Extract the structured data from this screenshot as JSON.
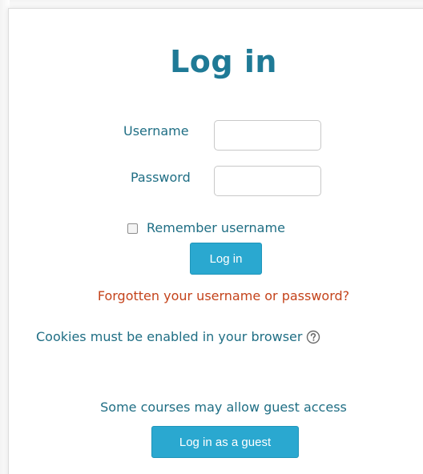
{
  "login": {
    "title": "Log in",
    "username_label": "Username",
    "username_value": "",
    "password_label": "Password",
    "password_value": "",
    "remember_label": "Remember username",
    "remember_checked": false,
    "login_button": "Log in",
    "forgot_link": "Forgotten your username or password?",
    "cookies_text": "Cookies must be enabled in your browser",
    "help_icon": "question-circle-icon",
    "guest_note": "Some courses may allow guest access",
    "guest_button": "Log in as a guest"
  },
  "colors": {
    "heading": "#1f7a96",
    "text": "#1f6e84",
    "link": "#c4431b",
    "button": "#2aa8d0"
  }
}
